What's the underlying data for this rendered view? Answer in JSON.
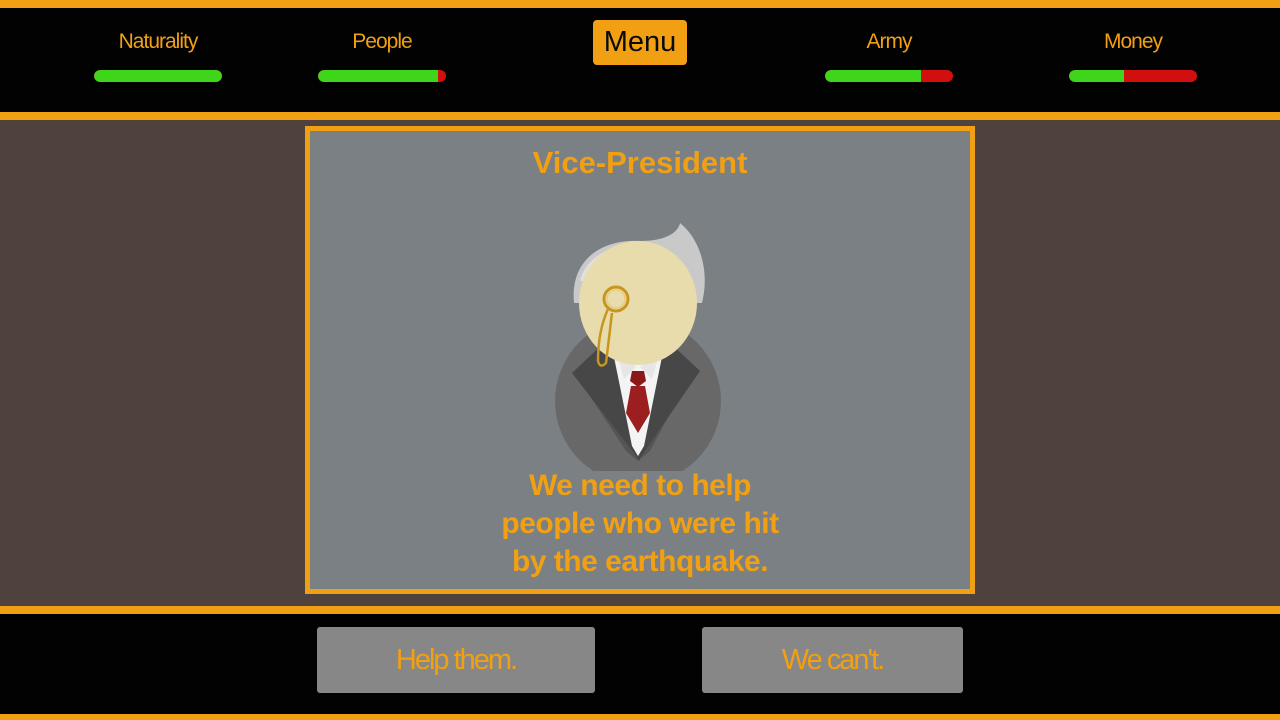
{
  "stats": [
    {
      "label": "Naturality",
      "level": 1.0
    },
    {
      "label": "People",
      "level": 0.94
    },
    {
      "label": "Army",
      "level": 0.75
    },
    {
      "label": "Money",
      "level": 0.43
    }
  ],
  "menu": {
    "label": "Menu"
  },
  "card": {
    "character": "Vice-President",
    "text_lines": [
      "We need to help",
      "people who were hit",
      "by the earthquake."
    ]
  },
  "choices": {
    "accept": "Help them.",
    "decline": "We can't."
  },
  "colors": {
    "accent": "#f0a012",
    "bar_good": "#3fd51a",
    "bar_bad": "#d20f0f",
    "background": "#4f423c",
    "card": "#7a8084"
  }
}
